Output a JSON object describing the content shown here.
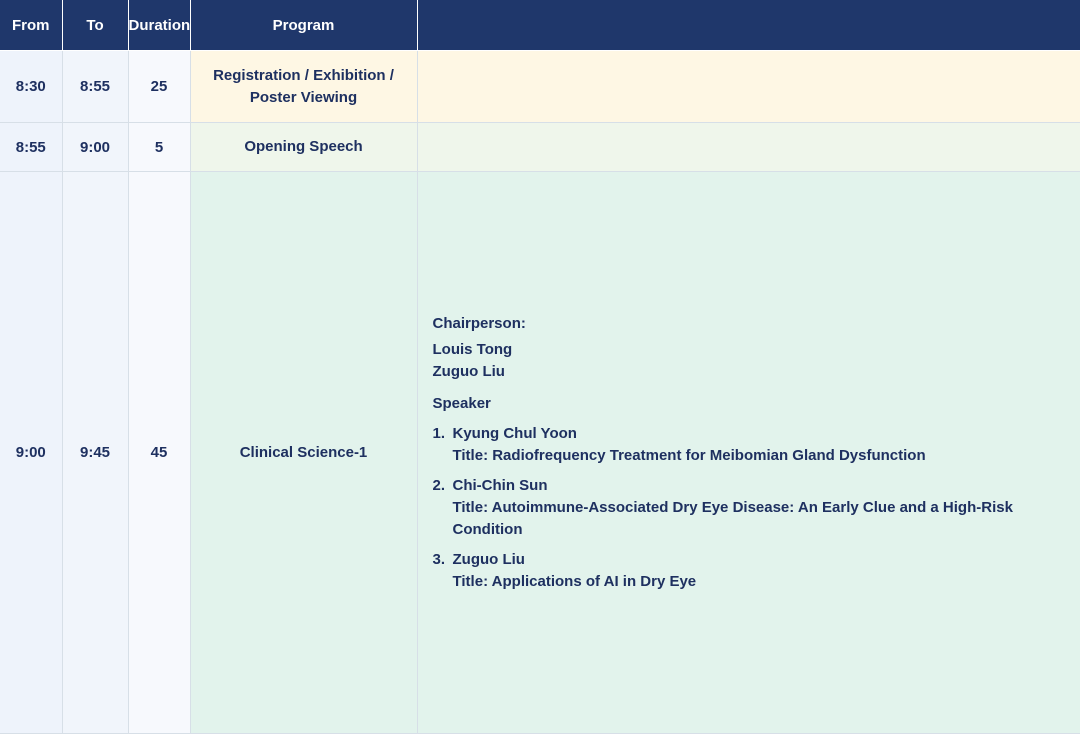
{
  "headers": {
    "from": "From",
    "to": "To",
    "duration": "Duration",
    "program": "Program",
    "details": ""
  },
  "rows": [
    {
      "from": "8:30",
      "to": "8:55",
      "duration": "25",
      "program_line1": "Registration / Exhibition /",
      "program_line2": "Poster Viewing"
    },
    {
      "from": "8:55",
      "to": "9:00",
      "duration": "5",
      "program": "Opening Speech"
    },
    {
      "from": "9:00",
      "to": "9:45",
      "duration": "45",
      "program": "Clinical Science-1",
      "details": {
        "chair_label": "Chairperson:",
        "chairs": [
          "Louis Tong",
          "Zuguo Liu"
        ],
        "speaker_label": "Speaker",
        "speakers": [
          {
            "num": "1.",
            "name": "Kyung Chul Yoon",
            "title": "Title: Radiofrequency Treatment for Meibomian Gland Dysfunction"
          },
          {
            "num": "2.",
            "name": "Chi-Chin Sun",
            "title": "Title: Autoimmune-Associated Dry Eye Disease: An Early Clue and a High-Risk Condition"
          },
          {
            "num": "3.",
            "name": "Zuguo Liu",
            "title": "Title: Applications of AI in Dry Eye"
          }
        ]
      }
    }
  ],
  "colors": {
    "header_bg": "#1f376b",
    "text": "#1e3060",
    "registration_bg": "#fef7e4",
    "opening_bg": "#eff6eb",
    "clinical_bg": "#e2f3ec",
    "time_col_bg": "#eef3fb"
  }
}
